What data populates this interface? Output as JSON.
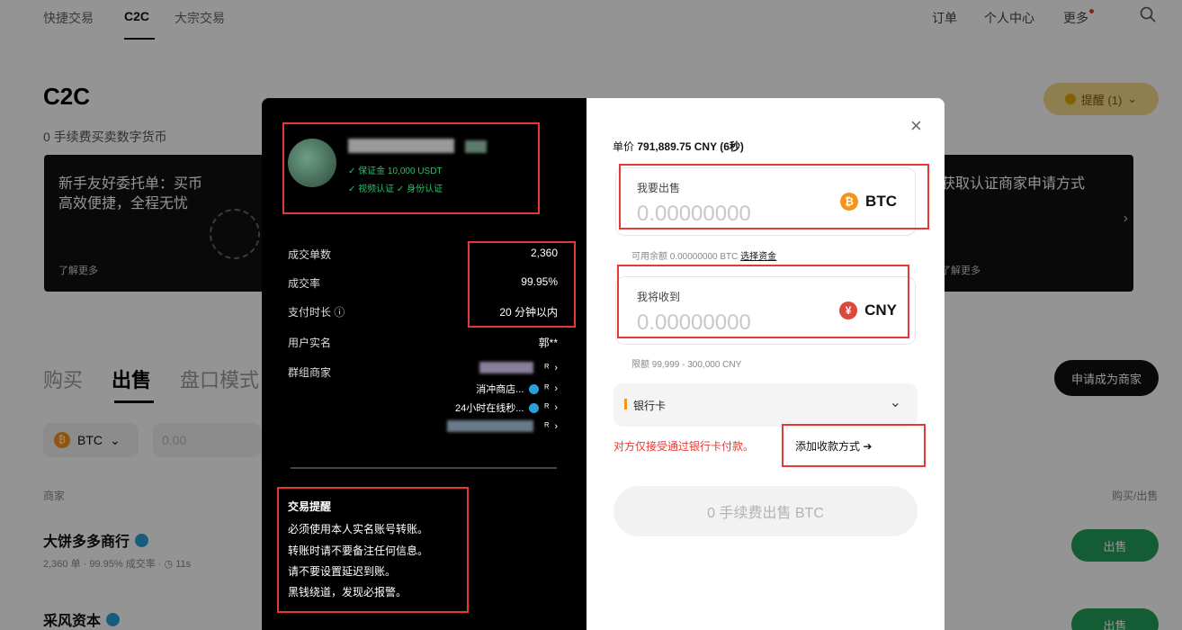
{
  "topnav": {
    "items": [
      "快捷交易",
      "C2C",
      "大宗交易"
    ],
    "active_index": 1,
    "right_items": [
      "订单",
      "个人中心",
      "更多"
    ],
    "search_icon": "search-icon"
  },
  "hero": {
    "title": "C2C",
    "subtitle": "0 手续费买卖数字货币",
    "remind_label": "提醒 (1)",
    "remind_chevron": "⌄"
  },
  "banners": [
    {
      "title_line1": "新手友好委托单：买币",
      "title_line2": "高效便捷，全程无忧",
      "more": "了解更多"
    },
    {
      "title_line1": "获取认证商家申请方式",
      "title_line2": "",
      "more": "了解更多"
    }
  ],
  "trade_tabs": {
    "items": [
      "购买",
      "出售",
      "盘口模式"
    ],
    "active_index": 1,
    "apply_button": "申请成为商家"
  },
  "filters": {
    "coin": "BTC",
    "coin_symbol": "₿",
    "amount_placeholder": "0.00"
  },
  "table": {
    "col_merchant": "商家",
    "col_action": "购买/出售",
    "rows": [
      {
        "name": "大饼多多商行",
        "stats": "2,360 单 · 99.95% 成交率 · ◷ 11s",
        "action": "出售"
      },
      {
        "name": "采风资本",
        "stats": "",
        "action": "出售"
      }
    ]
  },
  "modal": {
    "merchant": {
      "deposit_badge": "✓ 保证金 10,000 USDT",
      "verify_badges": "✓ 视频认证  ✓ 身份认证"
    },
    "stats": [
      {
        "label": "成交单数",
        "value": "2,360"
      },
      {
        "label": "成交率",
        "value": "99.95%"
      },
      {
        "label": "支付时长 ⓘ",
        "value": "20 分钟以内"
      },
      {
        "label": "用户实名",
        "value": "郭**"
      },
      {
        "label": "群组商家",
        "value": ""
      }
    ],
    "groups": [
      {
        "text": ""
      },
      {
        "text": "消冲商店..."
      },
      {
        "text": "24小时在线秒..."
      },
      {
        "text": ""
      }
    ],
    "tips": {
      "title": "交易提醒",
      "lines": [
        "必须使用本人实名账号转账。",
        "转账时请不要备注任何信息。",
        "请不要设置延迟到账。",
        "黑钱绕道，发现必报警。"
      ]
    },
    "right": {
      "close": "×",
      "price_label": "单价",
      "price_value": "791,889.75 CNY (6秒)",
      "sell_field": {
        "label": "我要出售",
        "value": "0.00000000",
        "currency": "BTC",
        "currency_symbol": "₿"
      },
      "available": {
        "text": "可用余额 0.00000000 BTC",
        "link": "选择资金"
      },
      "receive_field": {
        "label": "我将收到",
        "value": "0.00000000",
        "currency": "CNY",
        "currency_symbol": "¥"
      },
      "limit": "限额 99,999 - 300,000 CNY",
      "payment": {
        "label": "银行卡",
        "chevron": "⌄"
      },
      "warning": "对方仅接受通过银行卡付款。",
      "add_method": "添加收款方式 ➔",
      "submit": "0 手续费出售 BTC"
    }
  },
  "colors": {
    "accent_red": "#e53935",
    "sell_green": "#23a05a",
    "btc_orange": "#f7931a",
    "cny_red": "#d94a3c",
    "badge_green": "#2fbf6b"
  }
}
